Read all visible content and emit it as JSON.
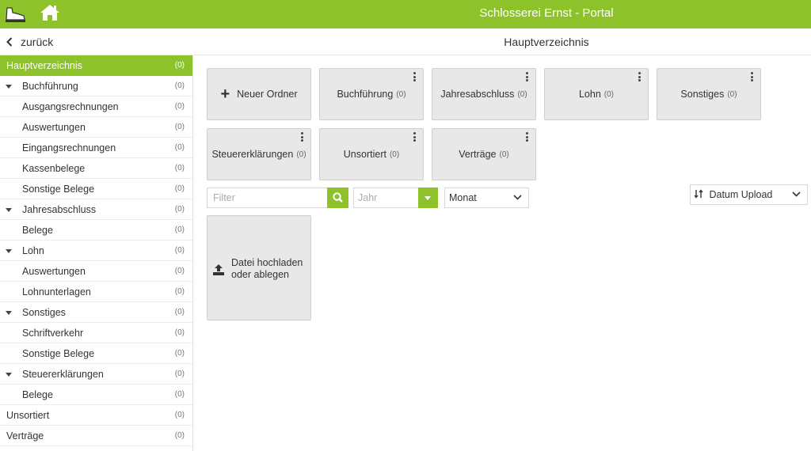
{
  "colors": {
    "accent": "#8dc22a"
  },
  "header": {
    "title": "Schlosserei Ernst - Portal",
    "logo_icon": "boot-logo-icon",
    "home_icon": "home-icon"
  },
  "subheader": {
    "back_label": "zurück",
    "title": "Hauptverzeichnis"
  },
  "sidebar": {
    "items": [
      {
        "label": "Hauptverzeichnis",
        "count": "(0)",
        "level": 0,
        "active": true
      },
      {
        "label": "Buchführung",
        "count": "(0)",
        "level": 1,
        "expandable": true
      },
      {
        "label": "Ausgangsrechnungen",
        "count": "(0)",
        "level": 2
      },
      {
        "label": "Auswertungen",
        "count": "(0)",
        "level": 2
      },
      {
        "label": "Eingangsrechnungen",
        "count": "(0)",
        "level": 2
      },
      {
        "label": "Kassenbelege",
        "count": "(0)",
        "level": 2
      },
      {
        "label": "Sonstige Belege",
        "count": "(0)",
        "level": 2
      },
      {
        "label": "Jahresabschluss",
        "count": "(0)",
        "level": 1,
        "expandable": true
      },
      {
        "label": "Belege",
        "count": "(0)",
        "level": 2
      },
      {
        "label": "Lohn",
        "count": "(0)",
        "level": 1,
        "expandable": true
      },
      {
        "label": "Auswertungen",
        "count": "(0)",
        "level": 2
      },
      {
        "label": "Lohnunterlagen",
        "count": "(0)",
        "level": 2
      },
      {
        "label": "Sonstiges",
        "count": "(0)",
        "level": 1,
        "expandable": true
      },
      {
        "label": "Schriftverkehr",
        "count": "(0)",
        "level": 2
      },
      {
        "label": "Sonstige Belege",
        "count": "(0)",
        "level": 2
      },
      {
        "label": "Steuererklärungen",
        "count": "(0)",
        "level": 1,
        "expandable": true
      },
      {
        "label": "Belege",
        "count": "(0)",
        "level": 2
      },
      {
        "label": "Unsortiert",
        "count": "(0)",
        "level": 0
      },
      {
        "label": "Verträge",
        "count": "(0)",
        "level": 0
      }
    ]
  },
  "main": {
    "new_folder_label": "Neuer Ordner",
    "folders": [
      {
        "label": "Buchführung",
        "count": "(0)"
      },
      {
        "label": "Jahresabschluss",
        "count": "(0)"
      },
      {
        "label": "Lohn",
        "count": "(0)"
      },
      {
        "label": "Sonstiges",
        "count": "(0)"
      },
      {
        "label": "Steuererklärungen",
        "count": "(0)"
      },
      {
        "label": "Unsortiert",
        "count": "(0)"
      },
      {
        "label": "Verträge",
        "count": "(0)"
      }
    ],
    "filter": {
      "placeholder": "Filter",
      "search_icon": "search-icon"
    },
    "year": {
      "placeholder": "Jahr"
    },
    "month": {
      "selected": "Monat"
    },
    "sort": {
      "selected": "Datum Upload",
      "sort_icon": "sort-icon"
    },
    "upload": {
      "line1": "Datei hochladen",
      "line2": "oder ablegen",
      "icon": "upload-icon"
    }
  }
}
